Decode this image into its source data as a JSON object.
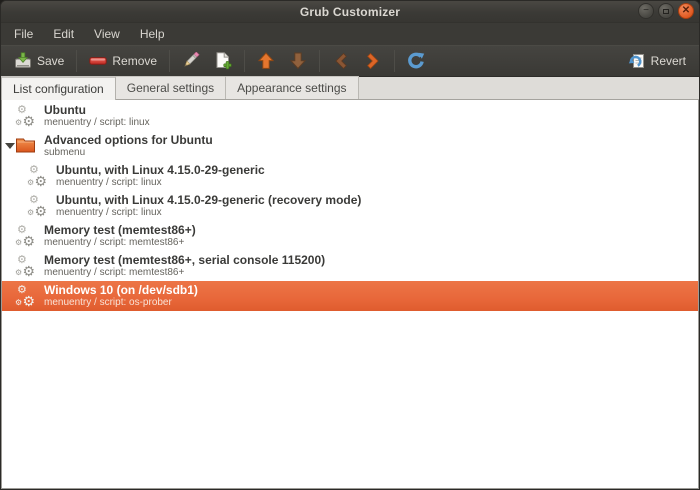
{
  "window": {
    "title": "Grub Customizer"
  },
  "menu": {
    "items": [
      "File",
      "Edit",
      "View",
      "Help"
    ]
  },
  "toolbar": {
    "save_label": "Save",
    "remove_label": "Remove",
    "revert_label": "Revert",
    "icon_buttons": [
      "rename-icon",
      "new-entry-icon",
      "move-up-icon",
      "move-down-icon",
      "move-left-icon",
      "move-right-icon",
      "refresh-icon"
    ]
  },
  "tabs": [
    {
      "label": "List configuration",
      "active": true
    },
    {
      "label": "General settings",
      "active": false
    },
    {
      "label": "Appearance settings",
      "active": false
    }
  ],
  "list": {
    "entries": [
      {
        "title": "Ubuntu",
        "subtitle": "menuentry / script: linux",
        "icon": "gears-icon",
        "indent": 0,
        "expander": false,
        "selected": false
      },
      {
        "title": "Advanced options for Ubuntu",
        "subtitle": "submenu",
        "icon": "folder-icon",
        "indent": 0,
        "expander": true,
        "selected": false
      },
      {
        "title": "Ubuntu, with Linux 4.15.0-29-generic",
        "subtitle": "menuentry / script: linux",
        "icon": "gears-icon",
        "indent": 1,
        "expander": false,
        "selected": false
      },
      {
        "title": "Ubuntu, with Linux 4.15.0-29-generic (recovery mode)",
        "subtitle": "menuentry / script: linux",
        "icon": "gears-icon",
        "indent": 1,
        "expander": false,
        "selected": false
      },
      {
        "title": "Memory test (memtest86+)",
        "subtitle": "menuentry / script: memtest86+",
        "icon": "gears-icon",
        "indent": 0,
        "expander": false,
        "selected": false
      },
      {
        "title": "Memory test (memtest86+, serial console 115200)",
        "subtitle": "menuentry / script: memtest86+",
        "icon": "gears-icon",
        "indent": 0,
        "expander": false,
        "selected": false
      },
      {
        "title": "Windows 10 (on /dev/sdb1)",
        "subtitle": "menuentry / script: os-prober",
        "icon": "gears-icon",
        "indent": 0,
        "expander": false,
        "selected": true
      }
    ]
  },
  "colors": {
    "selection": "#e8673a",
    "selection_light": "#ec7546",
    "selection_dark": "#df5c2e",
    "titlebar_bg": "#3b3a36",
    "content_bg": "#ffffff"
  }
}
